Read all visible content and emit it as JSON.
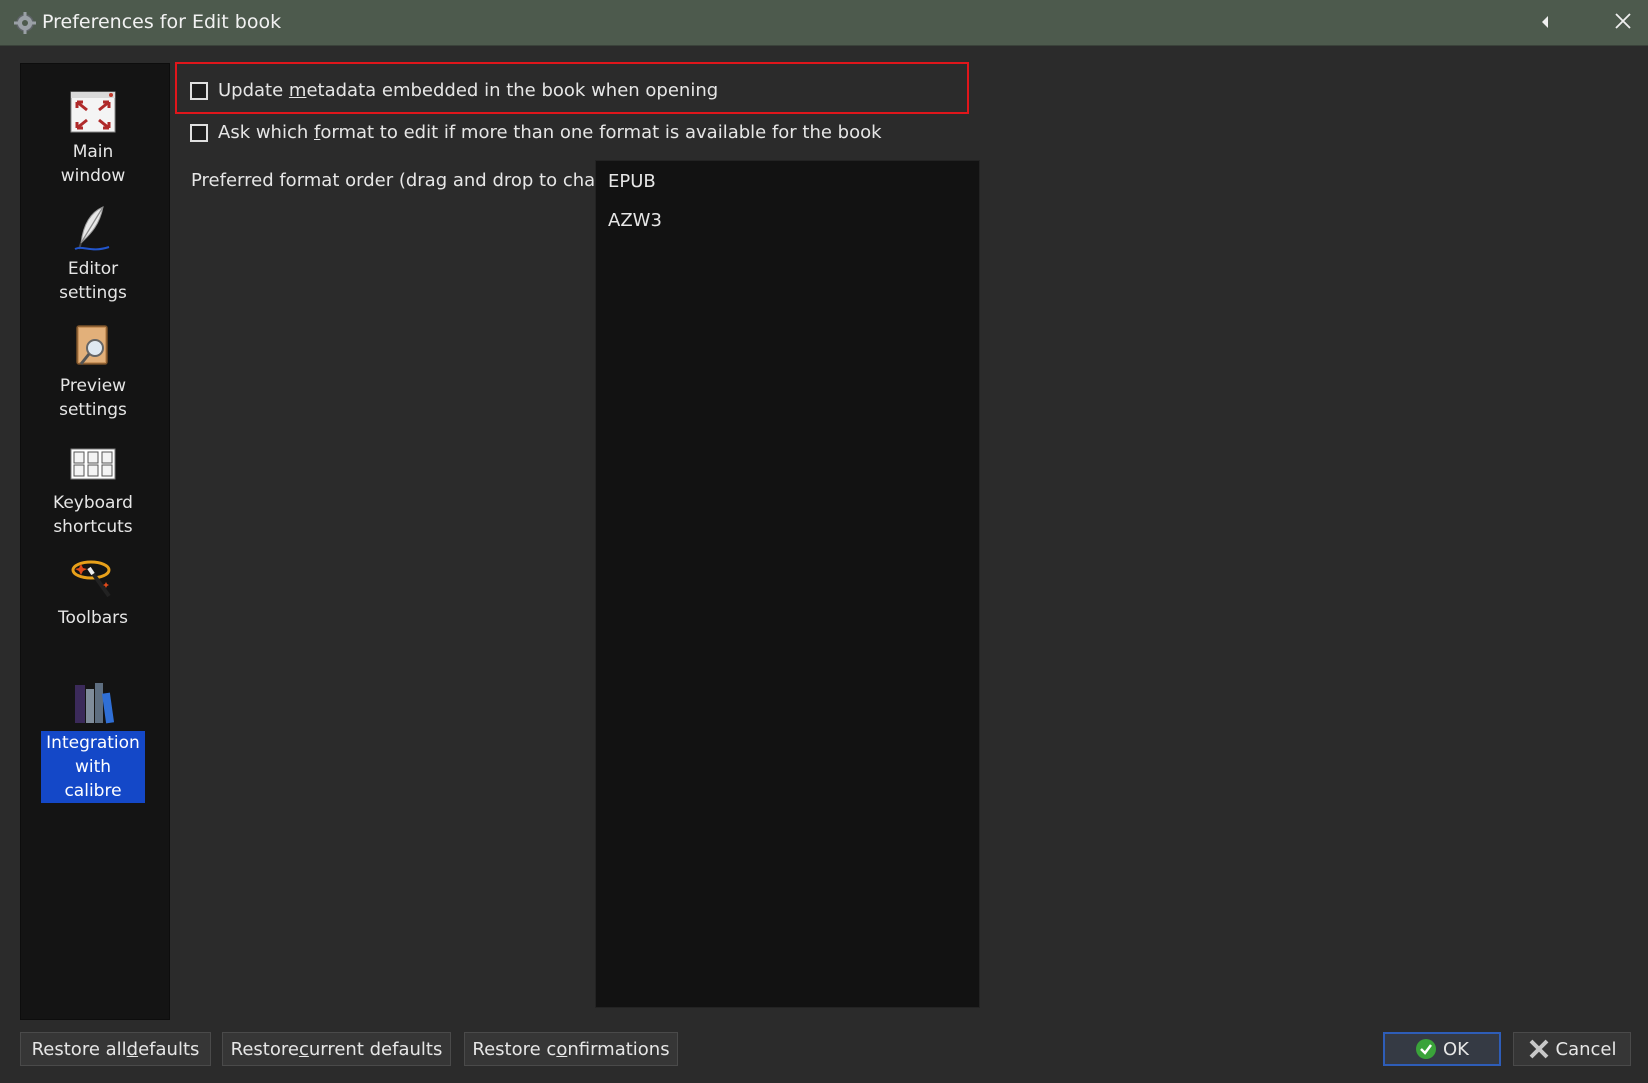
{
  "window": {
    "title": "Preferences for Edit book",
    "icon": "calibre-gear-icon"
  },
  "sidebar": {
    "items": [
      {
        "label": "Main\nwindow",
        "icon": "main-window-icon",
        "active": false
      },
      {
        "label": "Editor\nsettings",
        "icon": "feather-quill-icon",
        "active": false
      },
      {
        "label": "Preview\nsettings",
        "icon": "preview-book-magnifier-icon",
        "active": false
      },
      {
        "label": "Keyboard\nshortcuts",
        "icon": "keyboard-icon",
        "active": false
      },
      {
        "label": "Toolbars",
        "icon": "magic-wand-icon",
        "active": false
      },
      {
        "label": "Integration\nwith\ncalibre",
        "icon": "calibre-books-icon",
        "active": true
      }
    ]
  },
  "main": {
    "update_metadata": {
      "label_pre": "Update ",
      "label_mnemonic": "m",
      "label_post": "etadata embedded in the book when opening",
      "checked": false
    },
    "ask_format": {
      "label_pre": "Ask which ",
      "label_mnemonic": "f",
      "label_post": "ormat to edit if more than one format is available for the book",
      "checked": false
    },
    "format_order_label": "Preferred format order (drag and drop to change)",
    "formats": [
      "EPUB",
      "AZW3"
    ]
  },
  "footer": {
    "restore_all": {
      "pre": "Restore all ",
      "mn": "d",
      "post": "efaults"
    },
    "restore_current": {
      "pre": "Restore ",
      "mn": "c",
      "post": "urrent defaults"
    },
    "restore_confirm": {
      "pre": "Restore c",
      "mn": "o",
      "post": "nfirmations"
    },
    "ok": "OK",
    "cancel": "Cancel"
  },
  "colors": {
    "titlebar": "#4d5a4d",
    "accent_selected": "#1448c8",
    "highlight_border": "#e0161b"
  }
}
